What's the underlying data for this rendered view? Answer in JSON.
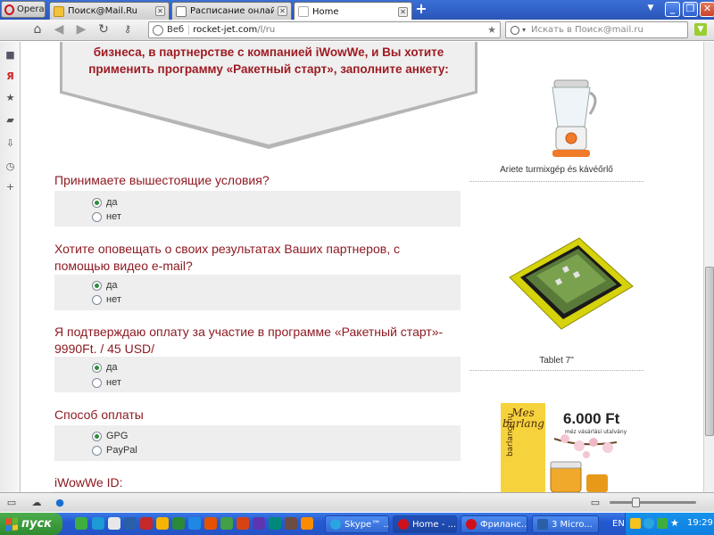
{
  "browser": {
    "menu_label": "Opera",
    "tabs": [
      {
        "title": "Поиск@Mail.Ru"
      },
      {
        "title": "Расписание онлайн пре..."
      },
      {
        "title": "Home"
      }
    ],
    "address": {
      "prefix": "Веб",
      "host": "rocket-jet.com",
      "path": "/l/ru"
    },
    "search_placeholder": "Искать в Поиск@mail.ru"
  },
  "page": {
    "ribbon_text": "бизнеса, в партнерстве с компанией iWowWe, и Вы хотите применить программу «Ракетный старт», заполните анкету:",
    "questions": [
      {
        "label": "Принимаете вышестоящие условия?",
        "options": [
          "да",
          "нет"
        ],
        "selected": 0
      },
      {
        "label": "Хотите оповещать о своих результатах Ваших партнеров, с помощью видео e-mail?",
        "options": [
          "да",
          "нет"
        ],
        "selected": 0
      },
      {
        "label": "Я подтверждаю оплату за участие в программе «Ракетный старт»- 9990Ft. / 45 USD/",
        "options": [
          "да",
          "нет"
        ],
        "selected": 0
      },
      {
        "label": "Способ оплаты",
        "options": [
          "GPG",
          "PayPal"
        ],
        "selected": 0
      },
      {
        "label": "iWowWe ID:"
      }
    ],
    "products": [
      {
        "caption": "Ariete turmixgép és kávéőrlő"
      },
      {
        "caption": "Tablet 7\""
      },
      {
        "ad_brand": "Mes barlang",
        "ad_price": "6.000 Ft",
        "ad_sub": "méz vásárlási utalvány",
        "ad_domain": "barlang.hu"
      }
    ]
  },
  "taskbar": {
    "start_label": "пуск",
    "tasks": [
      {
        "label": "Skype™ ..."
      },
      {
        "label": "Home - ..."
      },
      {
        "label": "Фриланс..."
      },
      {
        "label": "3 Micro..."
      }
    ],
    "lang": "EN",
    "time": "19:29"
  }
}
